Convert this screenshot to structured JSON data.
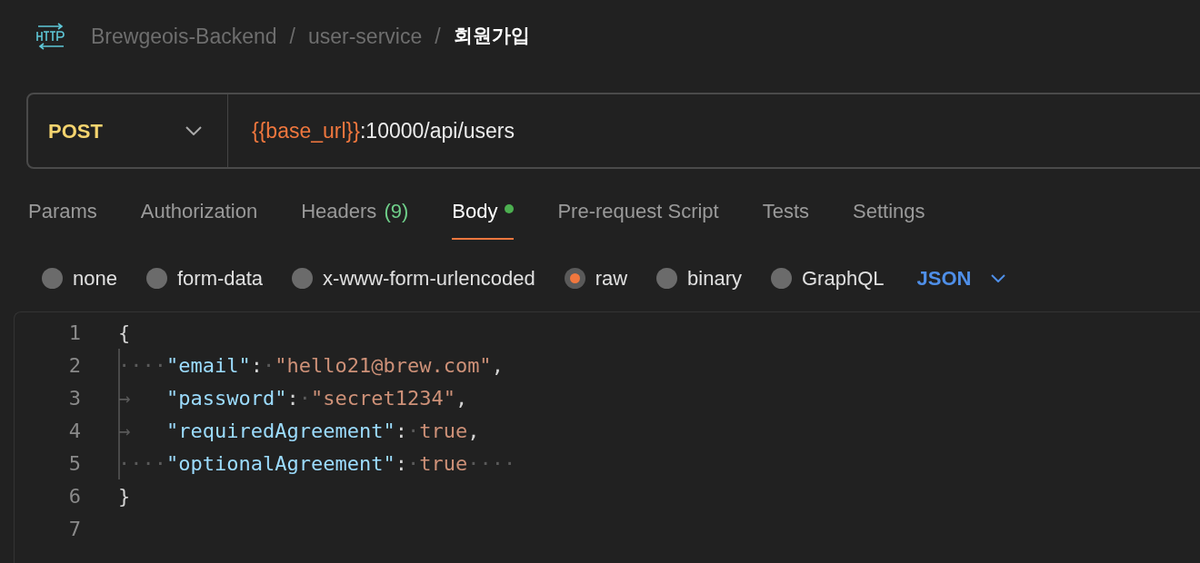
{
  "breadcrumb": {
    "items": [
      {
        "text": "Brewgeois-Backend",
        "current": false
      },
      {
        "text": "user-service",
        "current": false
      },
      {
        "text": "회원가입",
        "current": true
      }
    ],
    "separator": "/"
  },
  "request": {
    "method": "POST",
    "url": [
      {
        "text": "{{base_url}}",
        "kind": "variable"
      },
      {
        "text": ":10000/api/users",
        "kind": "plain"
      }
    ]
  },
  "tabs": [
    {
      "label": "Params",
      "selected": false
    },
    {
      "label": "Authorization",
      "selected": false
    },
    {
      "label": "Headers",
      "count": "(9)",
      "selected": false
    },
    {
      "label": "Body",
      "dot": true,
      "selected": true
    },
    {
      "label": "Pre-request Script",
      "selected": false
    },
    {
      "label": "Tests",
      "selected": false
    },
    {
      "label": "Settings",
      "selected": false
    }
  ],
  "body_types": [
    {
      "label": "none",
      "selected": false
    },
    {
      "label": "form-data",
      "selected": false
    },
    {
      "label": "x-www-form-urlencoded",
      "selected": false
    },
    {
      "label": "raw",
      "selected": true
    },
    {
      "label": "binary",
      "selected": false
    },
    {
      "label": "GraphQL",
      "selected": false
    }
  ],
  "format": "JSON",
  "editor": {
    "lines": [
      {
        "number": "1",
        "guide": false,
        "tokens": [
          {
            "text": "{",
            "kind": "punct"
          }
        ]
      },
      {
        "number": "2",
        "guide": true,
        "tokens": [
          {
            "text": "····",
            "kind": "ws"
          },
          {
            "text": "\"email\"",
            "kind": "key"
          },
          {
            "text": ":",
            "kind": "punct"
          },
          {
            "text": "·",
            "kind": "ws"
          },
          {
            "text": "\"hello21@brew.com\"",
            "kind": "string"
          },
          {
            "text": ",",
            "kind": "punct"
          }
        ]
      },
      {
        "number": "3",
        "guide": true,
        "tokens": [
          {
            "text": "→   ",
            "kind": "ws"
          },
          {
            "text": "\"password\"",
            "kind": "key"
          },
          {
            "text": ":",
            "kind": "punct"
          },
          {
            "text": "·",
            "kind": "ws"
          },
          {
            "text": "\"secret1234\"",
            "kind": "string"
          },
          {
            "text": ",",
            "kind": "punct"
          }
        ]
      },
      {
        "number": "4",
        "guide": true,
        "tokens": [
          {
            "text": "→   ",
            "kind": "ws"
          },
          {
            "text": "\"requiredAgreement\"",
            "kind": "key"
          },
          {
            "text": ":",
            "kind": "punct"
          },
          {
            "text": "·",
            "kind": "ws"
          },
          {
            "text": "true",
            "kind": "bool"
          },
          {
            "text": ",",
            "kind": "punct"
          }
        ]
      },
      {
        "number": "5",
        "guide": true,
        "tokens": [
          {
            "text": "····",
            "kind": "ws"
          },
          {
            "text": "\"optionalAgreement\"",
            "kind": "key"
          },
          {
            "text": ":",
            "kind": "punct"
          },
          {
            "text": "·",
            "kind": "ws"
          },
          {
            "text": "true",
            "kind": "bool"
          },
          {
            "text": "····",
            "kind": "ws"
          }
        ]
      },
      {
        "number": "6",
        "guide": false,
        "tokens": [
          {
            "text": "}",
            "kind": "punct"
          }
        ]
      },
      {
        "number": "7",
        "guide": false
      }
    ]
  }
}
